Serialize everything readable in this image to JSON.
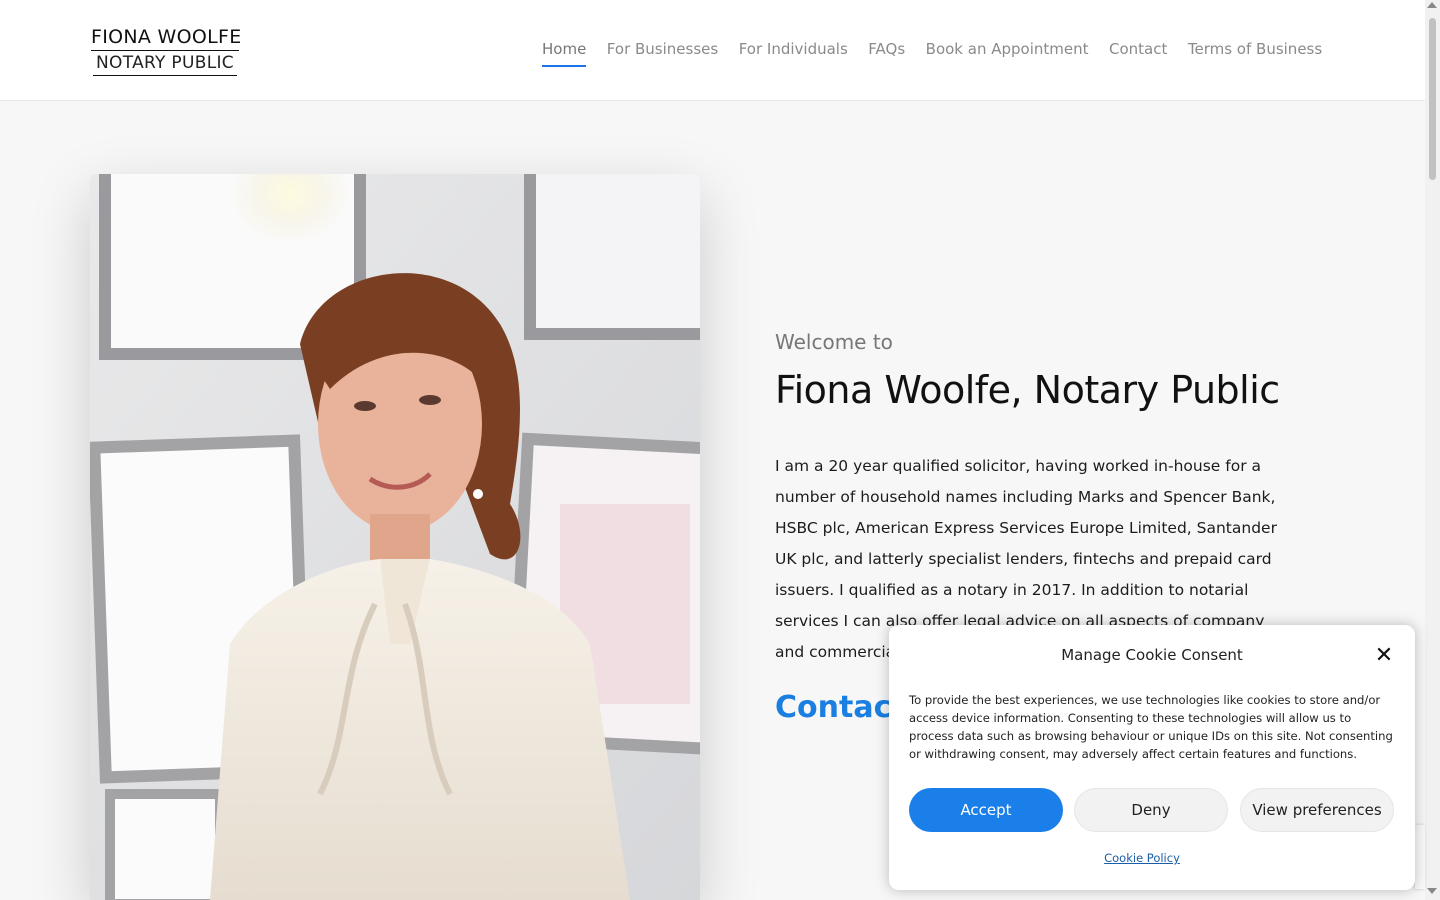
{
  "header": {
    "logo_top": "FIONA WOOLFE",
    "logo_bottom": "NOTARY PUBLIC",
    "nav": [
      {
        "label": "Home",
        "active": true
      },
      {
        "label": "For Businesses"
      },
      {
        "label": "For Individuals"
      },
      {
        "label": "FAQs"
      },
      {
        "label": "Book an Appointment"
      },
      {
        "label": "Contact"
      },
      {
        "label": "Terms of Business"
      }
    ]
  },
  "hero": {
    "welcome": "Welcome to",
    "title": "Fiona Woolfe, Notary Public",
    "intro": "I am a 20 year qualified solicitor, having worked in-house for a number of household names including Marks and Spencer Bank, HSBC plc, American Express Services Europe Limited, Santander UK plc, and latterly specialist lenders, fintechs and prepaid card issuers. I qualified as a notary in 2017. In addition to notarial services I can also offer legal advice on all aspects of company and commercial work.",
    "contact_link": "Contact",
    "photo_alt": "Portrait photo"
  },
  "cookie": {
    "title": "Manage Cookie Consent",
    "text": "To provide the best experiences, we use technologies like cookies to store and/or access device information. Consenting to these technologies will allow us to process data such as browsing behaviour or unique IDs on this site. Not consenting or withdrawing consent, may adversely affect certain features and functions.",
    "accept": "Accept",
    "deny": "Deny",
    "view_prefs": "View preferences",
    "policy": "Cookie Policy",
    "close_icon": "close-icon"
  },
  "colors": {
    "accent": "#1a7fe8",
    "nav_text": "#8a8a8a",
    "page_bg": "#f7f7f7"
  }
}
